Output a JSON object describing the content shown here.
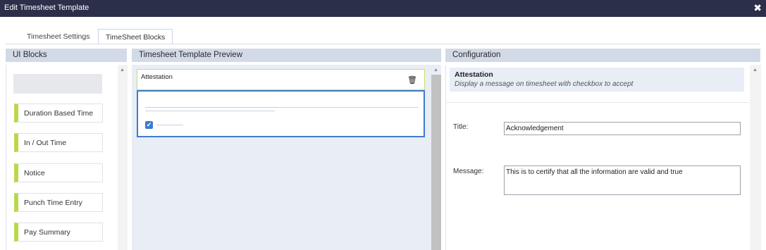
{
  "window": {
    "title": "Edit Timesheet Template",
    "close_icon": "close-icon"
  },
  "tabs": [
    {
      "label": "Timesheet Settings"
    },
    {
      "label": "TimeSheet Blocks"
    }
  ],
  "panels": {
    "ui_blocks": {
      "title": "UI Blocks",
      "items": [
        {
          "label": "Duration Based Time"
        },
        {
          "label": "In / Out Time"
        },
        {
          "label": "Notice"
        },
        {
          "label": "Punch Time Entry"
        },
        {
          "label": "Pay Summary"
        }
      ]
    },
    "preview": {
      "title": "Timesheet Template Preview",
      "block_title": "Attestation",
      "trash_icon": "trash-icon"
    },
    "configuration": {
      "title": "Configuration",
      "block_name": "Attestation",
      "block_description": "Display a message on timesheet with checkbox to accept",
      "title_label": "Title:",
      "title_value": "Acknowledgement",
      "message_label": "Message:",
      "message_value": "This is to certify that all the information are valid and true"
    }
  },
  "colors": {
    "titlebar": "#2b2f4a",
    "accent": "#b9d94a",
    "selected_border": "#3d7bd1",
    "panel_header": "#d2dae7"
  }
}
